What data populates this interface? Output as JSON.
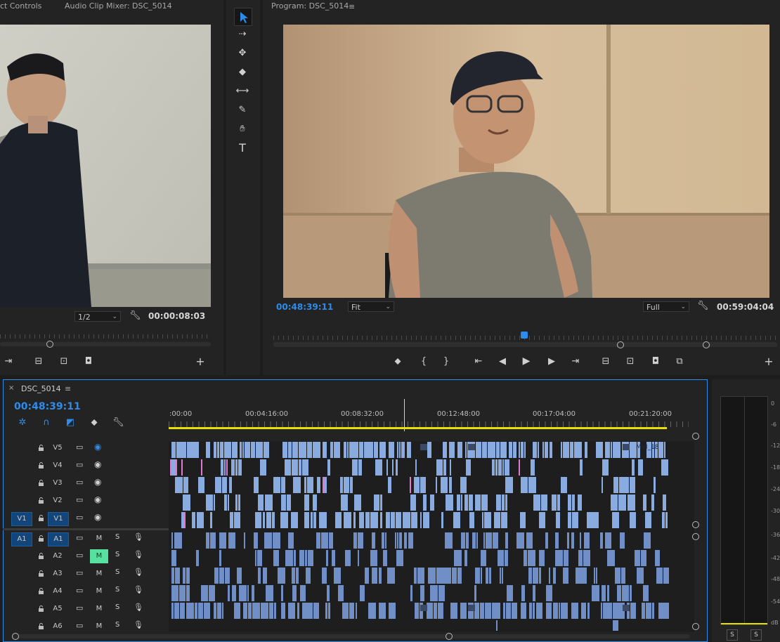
{
  "source_monitor": {
    "tab_effect_controls": "ct Controls",
    "tab_audio_mixer": "Audio Clip Mixer: DSC_5014",
    "resolution": "1/2",
    "timecode": "00:00:08:03"
  },
  "program_monitor": {
    "title": "Program: DSC_5014",
    "timecode_current": "00:48:39:11",
    "fit": "Fit",
    "quality": "Full",
    "timecode_duration": "00:59:04:04"
  },
  "timeline": {
    "sequence_name": "DSC_5014",
    "timecode": "00:48:39:11",
    "ruler_labels": [
      ":00:00",
      "00:04:16:00",
      "00:08:32:00",
      "00:12:48:00",
      "00:17:04:00",
      "00:21:20:00"
    ],
    "video_tracks": [
      {
        "name": "V5",
        "source": "",
        "clip_label": "MVI_18"
      },
      {
        "name": "V4",
        "source": ""
      },
      {
        "name": "V3",
        "source": ""
      },
      {
        "name": "V2",
        "source": ""
      },
      {
        "name": "V1",
        "source": "V1"
      }
    ],
    "audio_tracks": [
      {
        "name": "A1",
        "source": "A1",
        "mute": "M",
        "solo": "S"
      },
      {
        "name": "A2",
        "source": "",
        "mute": "M",
        "solo": "S"
      },
      {
        "name": "A3",
        "source": "",
        "mute": "M",
        "solo": "S"
      },
      {
        "name": "A4",
        "source": "",
        "mute": "M",
        "solo": "S"
      },
      {
        "name": "A5",
        "source": "",
        "mute": "M",
        "solo": "S"
      },
      {
        "name": "A6",
        "source": "",
        "mute": "M",
        "solo": "S"
      }
    ]
  },
  "audio_meter": {
    "scale": [
      "0",
      "-6",
      "-12",
      "-18",
      "-24",
      "-30",
      "-36",
      "-42",
      "-48",
      "-54",
      "dB"
    ],
    "solo_left": "S",
    "solo_right": "S"
  },
  "colors": {
    "accent_blue": "#2d8ceb",
    "clip_video": "#8aabe0",
    "clip_audio": "#6f8fc6",
    "playhead_bar": "#e8e000",
    "mute_active": "#58e0a0"
  }
}
